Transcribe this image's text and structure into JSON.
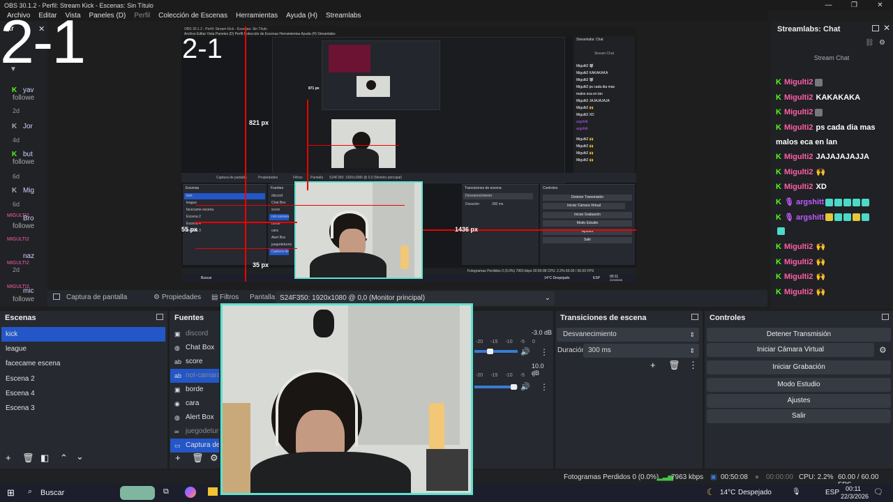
{
  "window": {
    "title": "OBS 30.1.2 - Perfil: Stream Kick - Escenas: Sin Título",
    "controls": [
      "—",
      "❐",
      "✕"
    ]
  },
  "menu": {
    "items": [
      "Archivo",
      "Editar",
      "Vista",
      "Paneles (D)",
      "Perfil",
      "Colección de Escenas",
      "Herramientas",
      "Ayuda (H)",
      "Streamlabs"
    ]
  },
  "overlay_text": {
    "big": "2-1",
    "nested_big": "2-1"
  },
  "activity": {
    "header": "Str",
    "items": [
      {
        "name": "yav",
        "event": "followe",
        "time": "2d"
      },
      {
        "name": "Jor",
        "event": "",
        "time": "4d"
      },
      {
        "name": "but",
        "event": "followe",
        "time": "6d"
      },
      {
        "name": "Mig",
        "event": "",
        "time": "6d"
      },
      {
        "name": "Bro",
        "event": "followe",
        "time": ""
      },
      {
        "name": "naz",
        "event": "",
        "time": "2d"
      },
      {
        "name": "mic",
        "event": "followe",
        "time": ""
      }
    ],
    "tags": [
      "MIGULTI2",
      "MIGULTI2",
      "MIGULTI2",
      "MIGULTI2"
    ]
  },
  "nested": {
    "title": "OBS 30.1.2 - Perfil: Stream Kick - Escenas: Sin Título",
    "menu": "Archivo  Editar  Vista  Paneles (D)  Perfil  Colección de Escenas  Herramientas  Ayuda (H)  Streamlabs",
    "chat_header": "Streamlabs: Chat",
    "chat_sub": "Stream Chat",
    "chat_lines": [
      "Migulti2 🐺",
      "Migulti2 KAKAKAKA",
      "Migulti2 🐺",
      "Migulti2 ps cada dia mas",
      "malos eca en lan",
      "Migulti2 JAJAJAJAJA",
      "Migulti2 🙌",
      "Migulti2 XD",
      "argshitt",
      "argshitt",
      "Migulti2 🙌",
      "Migulti2 🙌",
      "Migulti2 🙌",
      "Migulti2 🙌"
    ],
    "measure_821": "821 px",
    "measure_871": "871 px",
    "measure_1436": "1436 px",
    "measure_55": "55 px",
    "measure_35": "35 px",
    "scenes_header": "Escenas",
    "scenes": [
      "kick",
      "league",
      "facecame escena",
      "Escena 2",
      "Escena 4",
      "Escena 3"
    ],
    "sources_header": "Fuentes",
    "sources": [
      "discord",
      "Chat Box",
      "score",
      "not-camara",
      "borde",
      "cara",
      "Alert Box",
      "juegodeturno",
      "Captura de"
    ],
    "transitions_header": "Transiciones de escena",
    "transition": "Desvanecimiento",
    "duration_label": "Duración",
    "duration": "300 ms",
    "controls_header": "Controles",
    "controls": [
      "Detener Transmisión",
      "Iniciar Cámara Virtual",
      "Iniciar Grabación",
      "Modo Estudio",
      "Ajustes",
      "Salir"
    ],
    "capture_label": "Captura de pantalla",
    "props": "Propiedades",
    "filters": "Filtros",
    "screen": "Pantalla",
    "monitor": "S24F350: 1920x1080 @ 0,0 (Monitor principal)",
    "status": "Fotogramas Perdidos 0 (0.0%)   7963 kbps   00:50:08   CPU: 2.2%   60.00 / 60.00 FPS",
    "taskbar_search": "Buscar",
    "taskbar_weather": "14°C Despejado",
    "taskbar_lang": "ESP",
    "taskbar_time": "00:11",
    "taskbar_date": "22/3/2026"
  },
  "source_toolbar": {
    "capture": "Captura de pantalla",
    "properties": "Propiedades",
    "filters": "Filtros",
    "screen_label": "Pantalla",
    "monitor": "S24F350: 1920x1080 @ 0,0 (Monitor principal)"
  },
  "chat": {
    "header": "Streamlabs: Chat",
    "sub": "Stream Chat",
    "lines": [
      {
        "user": "Migulti2",
        "text": "",
        "emotes": [
          "g"
        ]
      },
      {
        "user": "Migulti2",
        "text": "KAKAKAKA",
        "emotes": []
      },
      {
        "user": "Migulti2",
        "text": "",
        "emotes": [
          "g"
        ]
      },
      {
        "user": "Migulti2",
        "text": "ps cada dia mas",
        "emotes": []
      },
      {
        "user": "",
        "text": "malos eca en lan",
        "emotes": []
      },
      {
        "user": "Migulti2",
        "text": "JAJAJAJAJJA",
        "emotes": []
      },
      {
        "user": "Migulti2",
        "text": "🙌",
        "emotes": []
      },
      {
        "user": "Migulti2",
        "text": "XD",
        "emotes": []
      },
      {
        "user": "argshitt",
        "text": "",
        "emotes": [
          "c",
          "c",
          "c",
          "c",
          "c"
        ],
        "alt": true
      },
      {
        "user": "argshitt",
        "text": "",
        "emotes": [
          "y",
          "c",
          "c",
          "y",
          "c"
        ],
        "alt": true
      },
      {
        "user": "",
        "text": "",
        "emotes": [
          "c"
        ]
      },
      {
        "user": "Migulti2",
        "text": "🙌",
        "emotes": []
      },
      {
        "user": "Migulti2",
        "text": "🙌",
        "emotes": []
      },
      {
        "user": "Migulti2",
        "text": "🙌",
        "emotes": []
      },
      {
        "user": "Migulti2",
        "text": "🙌",
        "emotes": []
      }
    ]
  },
  "scenes": {
    "header": "Escenas",
    "items": [
      "kick",
      "league",
      "facecame escena",
      "Escena 2",
      "Escena 4",
      "Escena 3"
    ],
    "selected": "kick"
  },
  "sources": {
    "header": "Fuentes",
    "items": [
      {
        "icon": "image-icon",
        "label": "discord",
        "dim": true
      },
      {
        "icon": "browser-icon",
        "label": "Chat Box"
      },
      {
        "icon": "text-icon",
        "label": "score"
      },
      {
        "icon": "text-icon",
        "label": "not-camara",
        "dim": true,
        "selected": true
      },
      {
        "icon": "image-icon",
        "label": "borde"
      },
      {
        "icon": "camera-icon",
        "label": "cara"
      },
      {
        "icon": "browser-icon",
        "label": "Alert Box"
      },
      {
        "icon": "link-icon",
        "label": "juegodeturno",
        "dim": true
      },
      {
        "icon": "monitor-icon",
        "label": "Captura de",
        "selected": true
      }
    ]
  },
  "mixer": {
    "db1": "-3.0 dB",
    "db2": "10.0 dB",
    "ticks": [
      "-20",
      "-15",
      "-10",
      "-5",
      "0"
    ]
  },
  "transitions": {
    "header": "Transiciones de escena",
    "value": "Desvanecimiento",
    "duration_label": "Duración",
    "duration": "300 ms"
  },
  "controls": {
    "header": "Controles",
    "stop_stream": "Detener Transmisión",
    "virtual_cam": "Iniciar Cámara Virtual",
    "record": "Iniciar Grabación",
    "studio": "Modo Estudio",
    "settings": "Ajustes",
    "exit": "Salir"
  },
  "status": {
    "dropped": "Fotogramas Perdidos 0 (0.0%)",
    "kbps": "7963 kbps",
    "stream_time": "00:50:08",
    "rec_time": "00:00:00",
    "cpu": "CPU: 2.2%",
    "fps": "60.00 / 60.00 FPS"
  },
  "taskbar": {
    "search": "Buscar",
    "weather": "14°C",
    "weather_desc": "Despejado",
    "lang": "ESP",
    "time": "00:11",
    "date": "22/3/2026"
  },
  "colors": {
    "accent": "#2356c7",
    "kick": "#53fc18",
    "chat_user": "#ff5ea8",
    "cam_border": "#5de3d0",
    "guide": "#e00000"
  }
}
